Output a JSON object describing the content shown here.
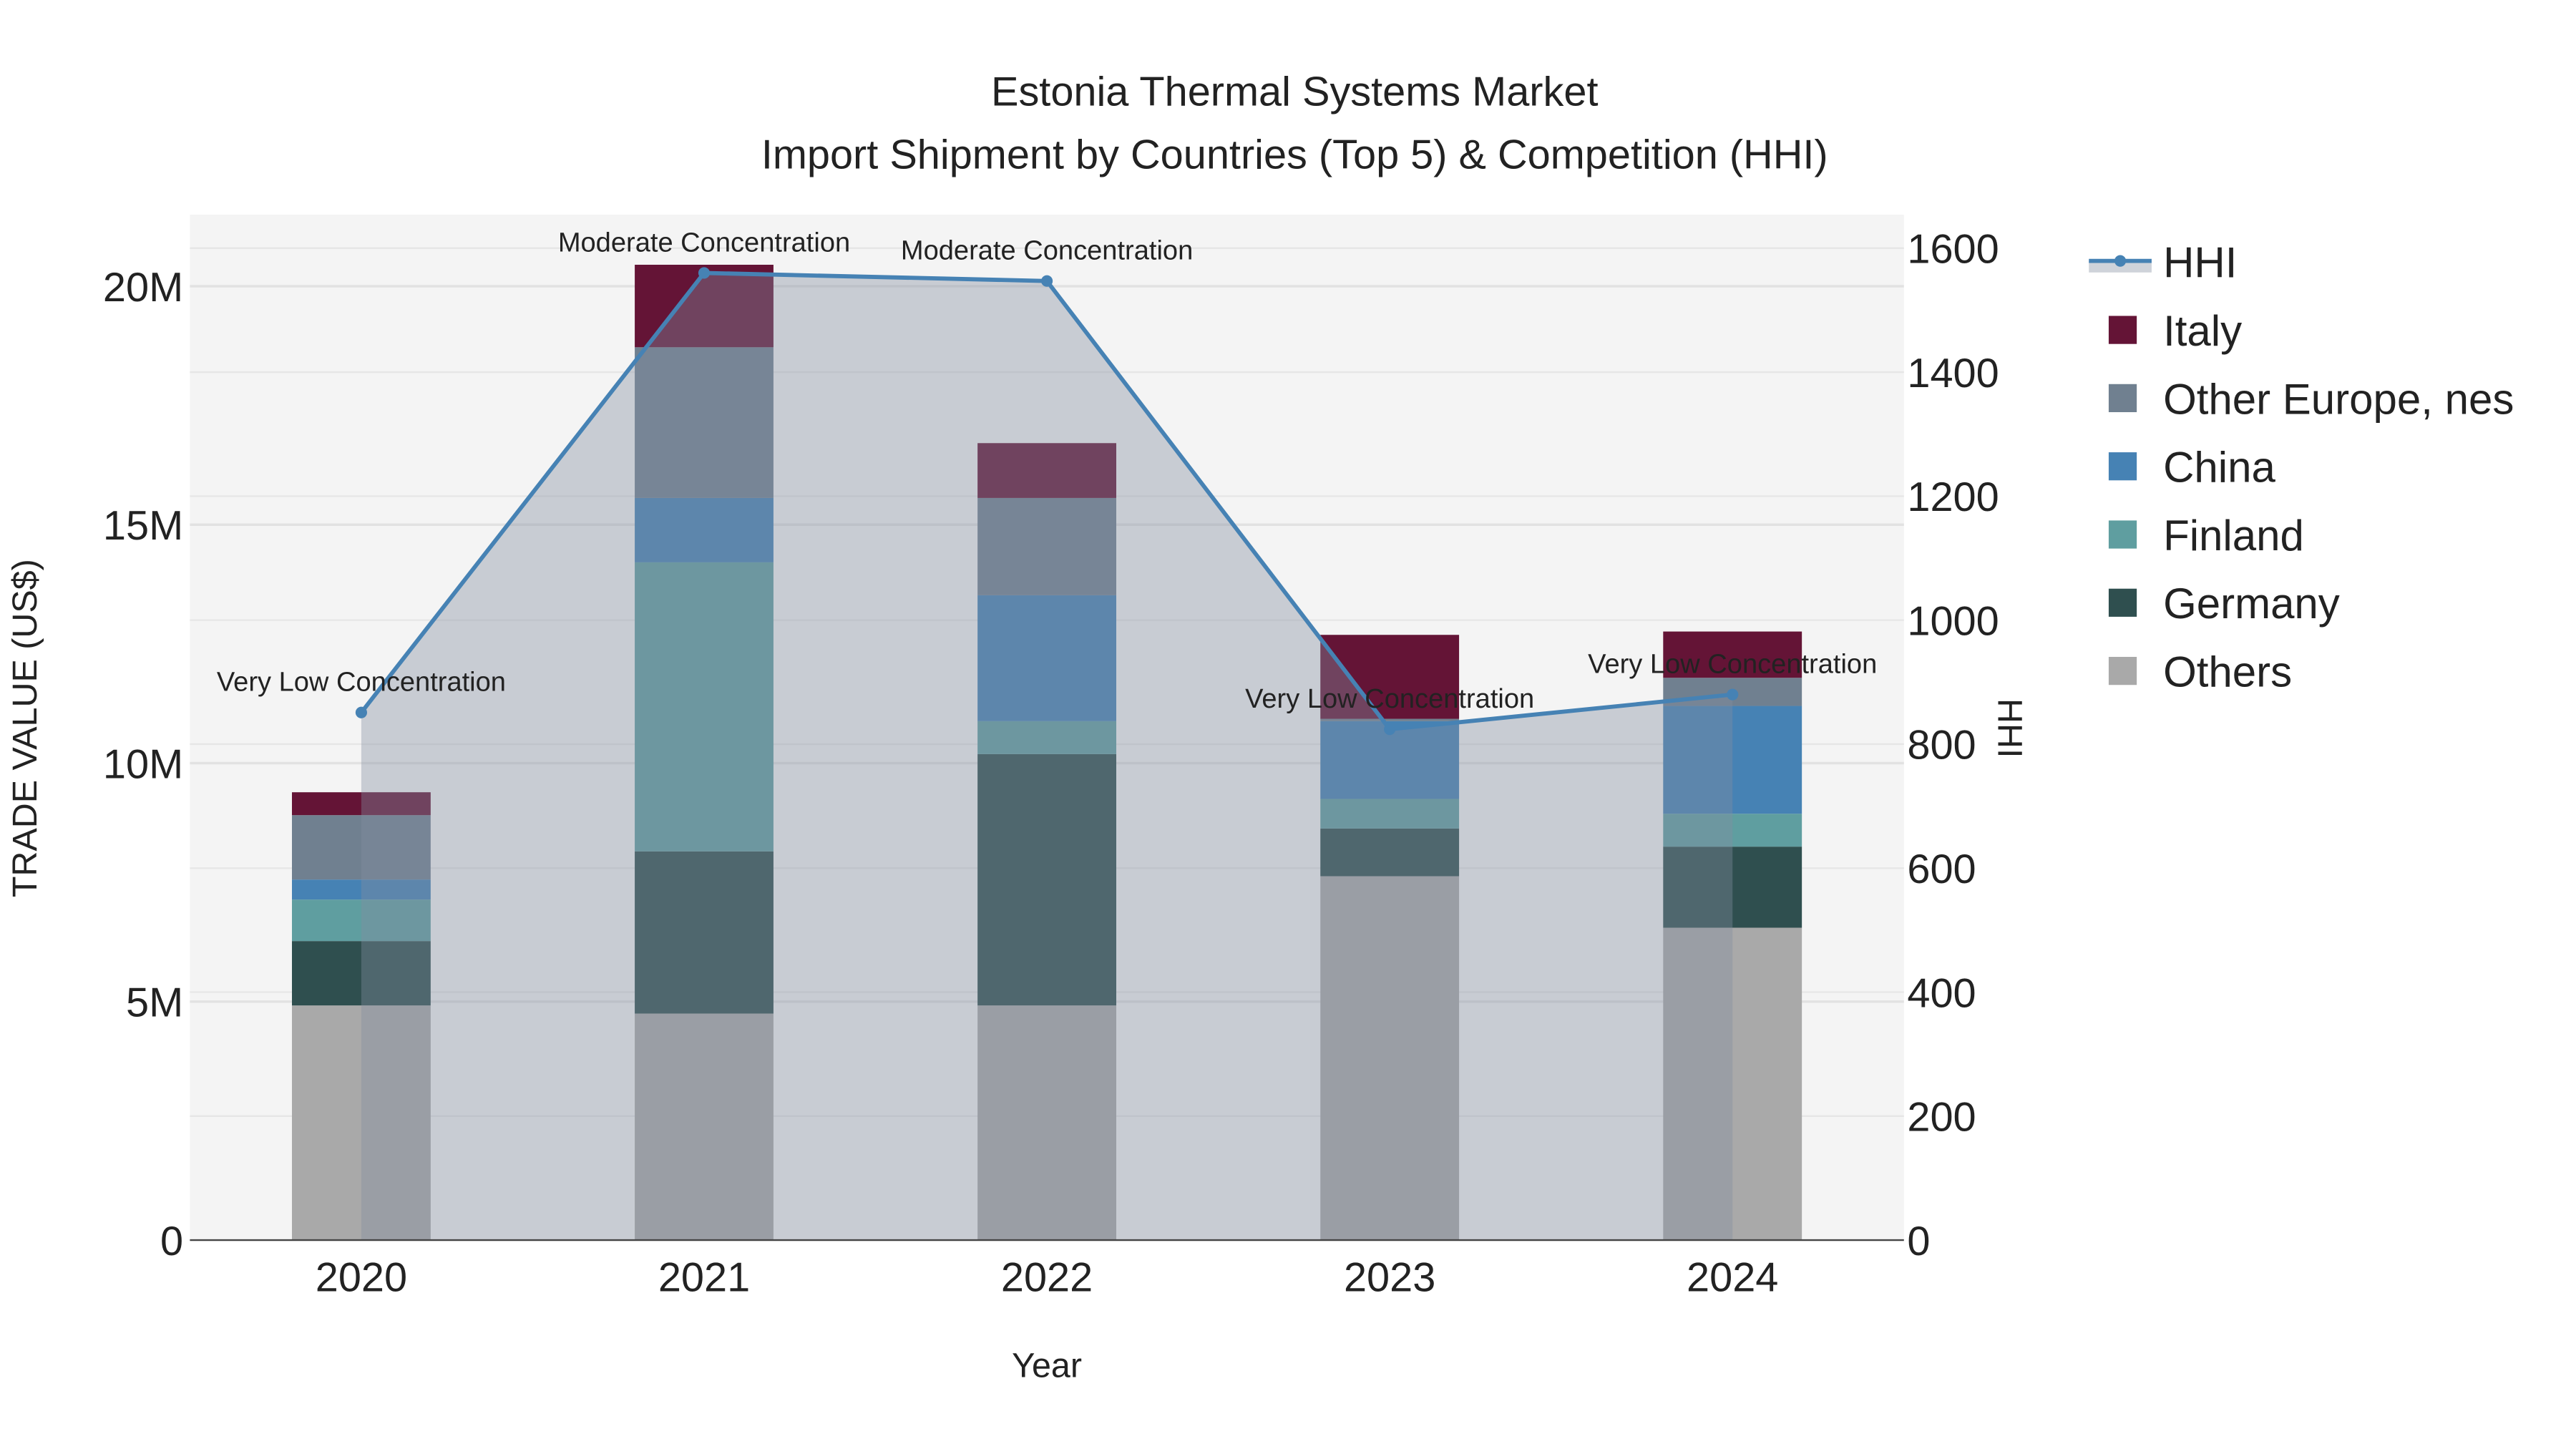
{
  "chart_data": {
    "type": "bar",
    "title": "Estonia Thermal Systems Market",
    "subtitle": "Import Shipment by Countries (Top 5) & Competition (HHI)",
    "xlabel": "Year",
    "ylabel": "TRADE VALUE (US$)",
    "y2label": "HHI",
    "categories": [
      "2020",
      "2021",
      "2022",
      "2023",
      "2024"
    ],
    "ylim": [
      0,
      21500000
    ],
    "y2lim": [
      0,
      1654
    ],
    "yticks": [
      {
        "v": 0,
        "label": "0"
      },
      {
        "v": 5000000,
        "label": "5M"
      },
      {
        "v": 10000000,
        "label": "10M"
      },
      {
        "v": 15000000,
        "label": "15M"
      },
      {
        "v": 20000000,
        "label": "20M"
      }
    ],
    "y2ticks": [
      {
        "v": 0,
        "label": "0"
      },
      {
        "v": 200,
        "label": "200"
      },
      {
        "v": 400,
        "label": "400"
      },
      {
        "v": 600,
        "label": "600"
      },
      {
        "v": 800,
        "label": "800"
      },
      {
        "v": 1000,
        "label": "1000"
      },
      {
        "v": 1200,
        "label": "1200"
      },
      {
        "v": 1400,
        "label": "1400"
      },
      {
        "v": 1600,
        "label": "1600"
      }
    ],
    "grid": true,
    "legend_position": "right",
    "series": [
      {
        "name": "Others",
        "color": "#a9a9a9",
        "values": [
          4920000,
          4750000,
          4920000,
          7630000,
          6550000
        ]
      },
      {
        "name": "Germany",
        "color": "#2f4f4f",
        "values": [
          1350000,
          3400000,
          5270000,
          1000000,
          1700000
        ]
      },
      {
        "name": "Finland",
        "color": "#5f9ea0",
        "values": [
          870000,
          6060000,
          690000,
          620000,
          690000
        ]
      },
      {
        "name": "China",
        "color": "#4682b4",
        "values": [
          420000,
          1350000,
          2640000,
          1630000,
          2260000
        ]
      },
      {
        "name": "Other Europe, nes",
        "color": "#708090",
        "values": [
          1350000,
          3160000,
          2040000,
          50000,
          590000
        ]
      },
      {
        "name": "Italy",
        "color": "#641436",
        "values": [
          480000,
          1730000,
          1150000,
          1760000,
          970000
        ]
      }
    ],
    "hhi": {
      "name": "HHI",
      "color": "#4682b4",
      "values": [
        851,
        1560,
        1547,
        824,
        880
      ],
      "annotations": [
        "Very Low Concentration",
        "Moderate Concentration",
        "Moderate Concentration",
        "Very Low Concentration",
        "Very Low Concentration"
      ]
    },
    "legend_order": [
      "HHI",
      "Italy",
      "Other Europe, nes",
      "China",
      "Finland",
      "Germany",
      "Others"
    ]
  }
}
